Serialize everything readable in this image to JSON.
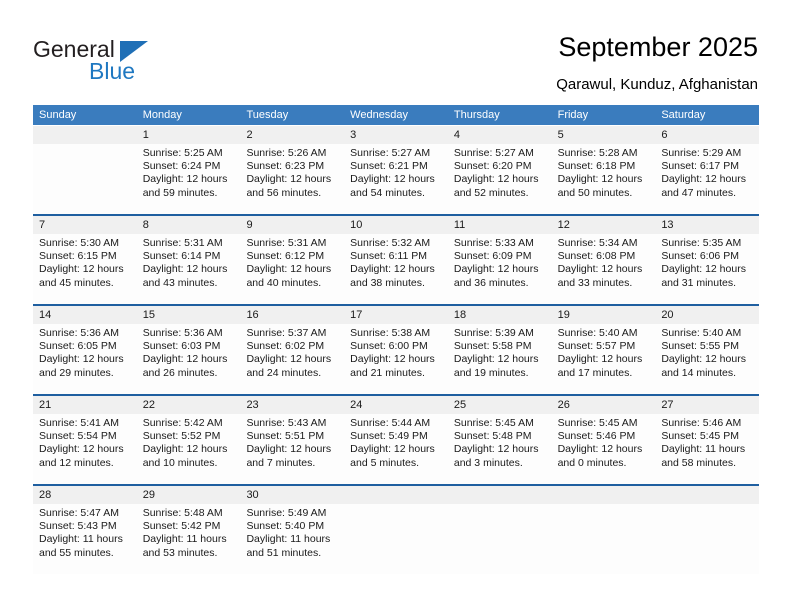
{
  "brand": {
    "name_top": "General",
    "name_bottom": "Blue",
    "color_text": "#231f20",
    "color_blue": "#1f78c1"
  },
  "header": {
    "title": "September 2025",
    "subtitle": "Qarawul, Kunduz, Afghanistan"
  },
  "theme": {
    "header_bg": "#3a7cbe",
    "week_sep": "#1f5fa0",
    "num_bg": "#f0f0f0"
  },
  "calendar": {
    "weekday_headers": [
      "Sunday",
      "Monday",
      "Tuesday",
      "Wednesday",
      "Thursday",
      "Friday",
      "Saturday"
    ],
    "weeks": [
      [
        {
          "day": "",
          "sunrise": "",
          "sunset": "",
          "daylight_1": "",
          "daylight_2": ""
        },
        {
          "day": "1",
          "sunrise": "Sunrise: 5:25 AM",
          "sunset": "Sunset: 6:24 PM",
          "daylight_1": "Daylight: 12 hours",
          "daylight_2": "and 59 minutes."
        },
        {
          "day": "2",
          "sunrise": "Sunrise: 5:26 AM",
          "sunset": "Sunset: 6:23 PM",
          "daylight_1": "Daylight: 12 hours",
          "daylight_2": "and 56 minutes."
        },
        {
          "day": "3",
          "sunrise": "Sunrise: 5:27 AM",
          "sunset": "Sunset: 6:21 PM",
          "daylight_1": "Daylight: 12 hours",
          "daylight_2": "and 54 minutes."
        },
        {
          "day": "4",
          "sunrise": "Sunrise: 5:27 AM",
          "sunset": "Sunset: 6:20 PM",
          "daylight_1": "Daylight: 12 hours",
          "daylight_2": "and 52 minutes."
        },
        {
          "day": "5",
          "sunrise": "Sunrise: 5:28 AM",
          "sunset": "Sunset: 6:18 PM",
          "daylight_1": "Daylight: 12 hours",
          "daylight_2": "and 50 minutes."
        },
        {
          "day": "6",
          "sunrise": "Sunrise: 5:29 AM",
          "sunset": "Sunset: 6:17 PM",
          "daylight_1": "Daylight: 12 hours",
          "daylight_2": "and 47 minutes."
        }
      ],
      [
        {
          "day": "7",
          "sunrise": "Sunrise: 5:30 AM",
          "sunset": "Sunset: 6:15 PM",
          "daylight_1": "Daylight: 12 hours",
          "daylight_2": "and 45 minutes."
        },
        {
          "day": "8",
          "sunrise": "Sunrise: 5:31 AM",
          "sunset": "Sunset: 6:14 PM",
          "daylight_1": "Daylight: 12 hours",
          "daylight_2": "and 43 minutes."
        },
        {
          "day": "9",
          "sunrise": "Sunrise: 5:31 AM",
          "sunset": "Sunset: 6:12 PM",
          "daylight_1": "Daylight: 12 hours",
          "daylight_2": "and 40 minutes."
        },
        {
          "day": "10",
          "sunrise": "Sunrise: 5:32 AM",
          "sunset": "Sunset: 6:11 PM",
          "daylight_1": "Daylight: 12 hours",
          "daylight_2": "and 38 minutes."
        },
        {
          "day": "11",
          "sunrise": "Sunrise: 5:33 AM",
          "sunset": "Sunset: 6:09 PM",
          "daylight_1": "Daylight: 12 hours",
          "daylight_2": "and 36 minutes."
        },
        {
          "day": "12",
          "sunrise": "Sunrise: 5:34 AM",
          "sunset": "Sunset: 6:08 PM",
          "daylight_1": "Daylight: 12 hours",
          "daylight_2": "and 33 minutes."
        },
        {
          "day": "13",
          "sunrise": "Sunrise: 5:35 AM",
          "sunset": "Sunset: 6:06 PM",
          "daylight_1": "Daylight: 12 hours",
          "daylight_2": "and 31 minutes."
        }
      ],
      [
        {
          "day": "14",
          "sunrise": "Sunrise: 5:36 AM",
          "sunset": "Sunset: 6:05 PM",
          "daylight_1": "Daylight: 12 hours",
          "daylight_2": "and 29 minutes."
        },
        {
          "day": "15",
          "sunrise": "Sunrise: 5:36 AM",
          "sunset": "Sunset: 6:03 PM",
          "daylight_1": "Daylight: 12 hours",
          "daylight_2": "and 26 minutes."
        },
        {
          "day": "16",
          "sunrise": "Sunrise: 5:37 AM",
          "sunset": "Sunset: 6:02 PM",
          "daylight_1": "Daylight: 12 hours",
          "daylight_2": "and 24 minutes."
        },
        {
          "day": "17",
          "sunrise": "Sunrise: 5:38 AM",
          "sunset": "Sunset: 6:00 PM",
          "daylight_1": "Daylight: 12 hours",
          "daylight_2": "and 21 minutes."
        },
        {
          "day": "18",
          "sunrise": "Sunrise: 5:39 AM",
          "sunset": "Sunset: 5:58 PM",
          "daylight_1": "Daylight: 12 hours",
          "daylight_2": "and 19 minutes."
        },
        {
          "day": "19",
          "sunrise": "Sunrise: 5:40 AM",
          "sunset": "Sunset: 5:57 PM",
          "daylight_1": "Daylight: 12 hours",
          "daylight_2": "and 17 minutes."
        },
        {
          "day": "20",
          "sunrise": "Sunrise: 5:40 AM",
          "sunset": "Sunset: 5:55 PM",
          "daylight_1": "Daylight: 12 hours",
          "daylight_2": "and 14 minutes."
        }
      ],
      [
        {
          "day": "21",
          "sunrise": "Sunrise: 5:41 AM",
          "sunset": "Sunset: 5:54 PM",
          "daylight_1": "Daylight: 12 hours",
          "daylight_2": "and 12 minutes."
        },
        {
          "day": "22",
          "sunrise": "Sunrise: 5:42 AM",
          "sunset": "Sunset: 5:52 PM",
          "daylight_1": "Daylight: 12 hours",
          "daylight_2": "and 10 minutes."
        },
        {
          "day": "23",
          "sunrise": "Sunrise: 5:43 AM",
          "sunset": "Sunset: 5:51 PM",
          "daylight_1": "Daylight: 12 hours",
          "daylight_2": "and 7 minutes."
        },
        {
          "day": "24",
          "sunrise": "Sunrise: 5:44 AM",
          "sunset": "Sunset: 5:49 PM",
          "daylight_1": "Daylight: 12 hours",
          "daylight_2": "and 5 minutes."
        },
        {
          "day": "25",
          "sunrise": "Sunrise: 5:45 AM",
          "sunset": "Sunset: 5:48 PM",
          "daylight_1": "Daylight: 12 hours",
          "daylight_2": "and 3 minutes."
        },
        {
          "day": "26",
          "sunrise": "Sunrise: 5:45 AM",
          "sunset": "Sunset: 5:46 PM",
          "daylight_1": "Daylight: 12 hours",
          "daylight_2": "and 0 minutes."
        },
        {
          "day": "27",
          "sunrise": "Sunrise: 5:46 AM",
          "sunset": "Sunset: 5:45 PM",
          "daylight_1": "Daylight: 11 hours",
          "daylight_2": "and 58 minutes."
        }
      ],
      [
        {
          "day": "28",
          "sunrise": "Sunrise: 5:47 AM",
          "sunset": "Sunset: 5:43 PM",
          "daylight_1": "Daylight: 11 hours",
          "daylight_2": "and 55 minutes."
        },
        {
          "day": "29",
          "sunrise": "Sunrise: 5:48 AM",
          "sunset": "Sunset: 5:42 PM",
          "daylight_1": "Daylight: 11 hours",
          "daylight_2": "and 53 minutes."
        },
        {
          "day": "30",
          "sunrise": "Sunrise: 5:49 AM",
          "sunset": "Sunset: 5:40 PM",
          "daylight_1": "Daylight: 11 hours",
          "daylight_2": "and 51 minutes."
        },
        {
          "day": "",
          "sunrise": "",
          "sunset": "",
          "daylight_1": "",
          "daylight_2": ""
        },
        {
          "day": "",
          "sunrise": "",
          "sunset": "",
          "daylight_1": "",
          "daylight_2": ""
        },
        {
          "day": "",
          "sunrise": "",
          "sunset": "",
          "daylight_1": "",
          "daylight_2": ""
        },
        {
          "day": "",
          "sunrise": "",
          "sunset": "",
          "daylight_1": "",
          "daylight_2": ""
        }
      ]
    ]
  }
}
